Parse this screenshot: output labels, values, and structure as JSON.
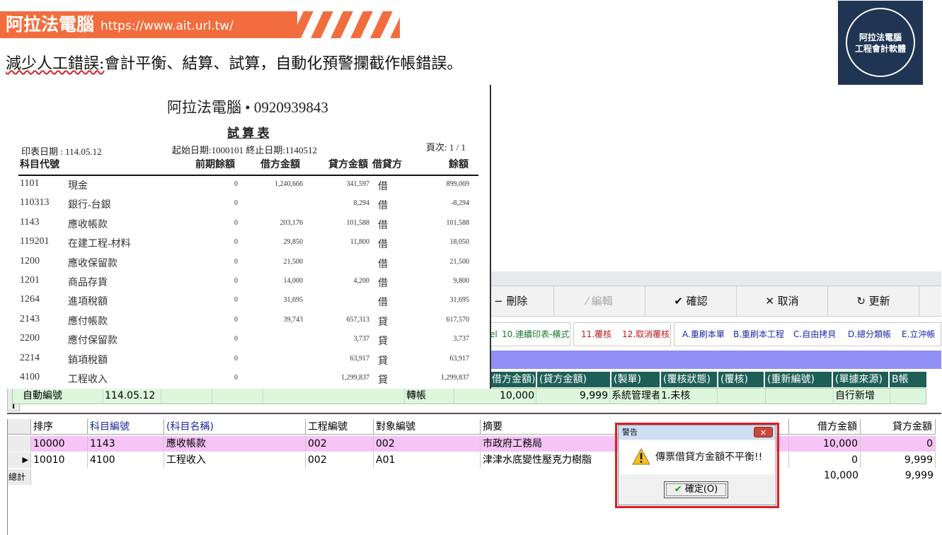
{
  "header": {
    "brand": "阿拉法電腦",
    "url": "https://www.ait.url.tw/",
    "subtitle_lead": "減少人工錯誤:",
    "subtitle_rest": "會計平衡、結算、試算，自動化預警攔截作帳錯誤。",
    "logo_line1": "阿拉法電腦",
    "logo_line2": "工程會計軟體"
  },
  "report": {
    "company": "阿拉法電腦 • 0920939843",
    "title": "試 算 表",
    "print_date": "印表日期 : 114.05.12",
    "date_range": "起始日期:1000101 終止日期:1140512",
    "page": "頁次: 1 / 1",
    "columns": [
      "科目代號",
      "前期餘額",
      "借方金額",
      "貸方金額",
      "借貸方",
      "餘額"
    ],
    "rows": [
      {
        "code": "1101",
        "name": "現金",
        "prev": "0",
        "debit": "1,240,666",
        "credit": "341,597",
        "dir": "借",
        "bal": "899,069"
      },
      {
        "code": "110313",
        "name": "銀行-台銀",
        "prev": "0",
        "debit": "",
        "credit": "8,294",
        "dir": "借",
        "bal": "-8,294"
      },
      {
        "code": "1143",
        "name": "應收帳款",
        "prev": "0",
        "debit": "203,176",
        "credit": "101,588",
        "dir": "借",
        "bal": "101,588"
      },
      {
        "code": "119201",
        "name": "在建工程-材料",
        "prev": "0",
        "debit": "29,850",
        "credit": "11,800",
        "dir": "借",
        "bal": "18,050"
      },
      {
        "code": "1200",
        "name": "應收保留款",
        "prev": "0",
        "debit": "21,500",
        "credit": "",
        "dir": "借",
        "bal": "21,500"
      },
      {
        "code": "1201",
        "name": "商品存貨",
        "prev": "0",
        "debit": "14,000",
        "credit": "4,200",
        "dir": "借",
        "bal": "9,800"
      },
      {
        "code": "1264",
        "name": "進項稅額",
        "prev": "0",
        "debit": "31,695",
        "credit": "",
        "dir": "借",
        "bal": "31,695"
      },
      {
        "code": "2143",
        "name": "應付帳款",
        "prev": "0",
        "debit": "39,743",
        "credit": "657,313",
        "dir": "貸",
        "bal": "617,570"
      },
      {
        "code": "2200",
        "name": "應付保留款",
        "prev": "0",
        "debit": "",
        "credit": "3,737",
        "dir": "貸",
        "bal": "3,737"
      },
      {
        "code": "2214",
        "name": "銷項稅額",
        "prev": "0",
        "debit": "",
        "credit": "63,917",
        "dir": "貸",
        "bal": "63,917"
      },
      {
        "code": "4100",
        "name": "工程收入",
        "prev": "0",
        "debit": "",
        "credit": "1,299,837",
        "dir": "貸",
        "bal": "1,299,837"
      }
    ]
  },
  "toolbar": {
    "delete": "− 刪除",
    "edit": "⁄ 編輯",
    "confirm": "✔ 確認",
    "cancel": "✕ 取消",
    "refresh": "↻ 更新"
  },
  "menu": {
    "excel_suffix": "el",
    "continuous_print": "10.連續印表-橫式",
    "review": "11.覆核",
    "cancel_review": "12.取消覆核",
    "reprint_doc": "A.重刷本單",
    "reprint_project": "B.重刷本工程",
    "free_copy": "C.自由拷貝",
    "general_ledger": "D.總分類帳",
    "offset": "E.立沖帳"
  },
  "master_headers": [
    "借方金額)",
    "(貸方金額)",
    "(製單)",
    "(覆核狀態)",
    "(覆核)",
    "(重新編號)",
    "(單據來源)",
    "B帳"
  ],
  "master_row": {
    "indicator": "I",
    "doc_no": "自動編號",
    "date": "114.05.12",
    "type": "轉帳",
    "debit": "10,000",
    "credit": "9,999",
    "maker": "系統管理者",
    "status": "1.未核",
    "source": "自行新增"
  },
  "detail": {
    "headers": [
      "排序",
      "科目編號",
      "(科目名稱)",
      "工程編號",
      "對象編號",
      "摘要",
      "借方金額",
      "貸方金額"
    ],
    "rows": [
      {
        "seq": "10000",
        "acct": "1143",
        "name": "應收帳款",
        "project": "002",
        "target": "002",
        "memo": "市政府工務局",
        "debit": "10,000",
        "credit": "0"
      },
      {
        "seq": "10010",
        "acct": "4100",
        "name": "工程收入",
        "project": "002",
        "target": "A01",
        "memo": "津津水底變性壓克力樹脂",
        "debit": "0",
        "credit": "9,999"
      }
    ],
    "total_label": "總計",
    "total_debit": "10,000",
    "total_credit": "9,999"
  },
  "dialog": {
    "title": "警告",
    "message": "傳票借貸方金額不平衡!!",
    "ok": "確定(O)"
  },
  "colors": {
    "banner": "#f26d3d",
    "logo_bg": "#203453",
    "header_teal": "#1d5f57",
    "purple_bar": "#8f8ff5",
    "master_green": "#dcf7dc",
    "row_pink": "#f6c4f6",
    "alert_red": "#e21d1d"
  }
}
